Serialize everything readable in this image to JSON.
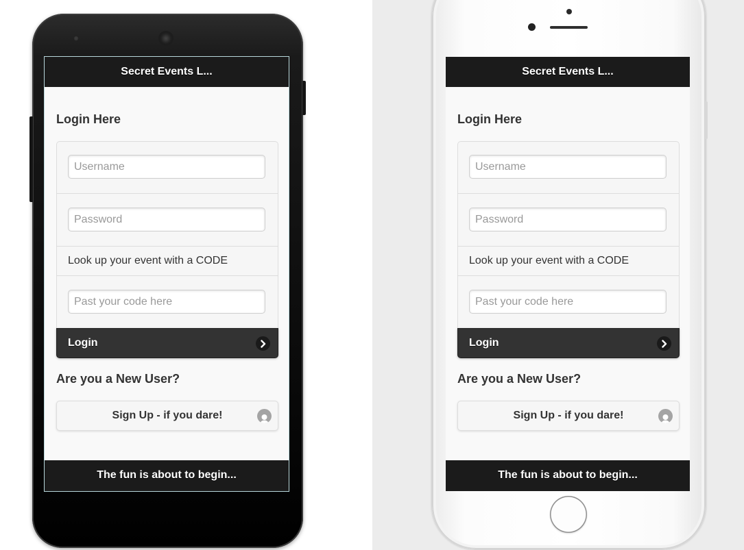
{
  "header": {
    "title": "Secret Events L..."
  },
  "login_section": {
    "heading": "Login Here",
    "username_placeholder": "Username",
    "password_placeholder": "Password",
    "lookup_label": "Look up your event with a CODE",
    "code_placeholder": "Past your code here",
    "login_button": "Login",
    "login_icon": "chevron-right-icon"
  },
  "signup_section": {
    "heading": "Are you a New User?",
    "signup_button": "Sign Up - if you dare!",
    "signup_icon": "user-icon"
  },
  "footer": {
    "text": "The fun is about to begin..."
  },
  "colors": {
    "header_bg": "#1b1b1b",
    "button_dark": "#333333",
    "page_bg": "#f9f9f9"
  }
}
